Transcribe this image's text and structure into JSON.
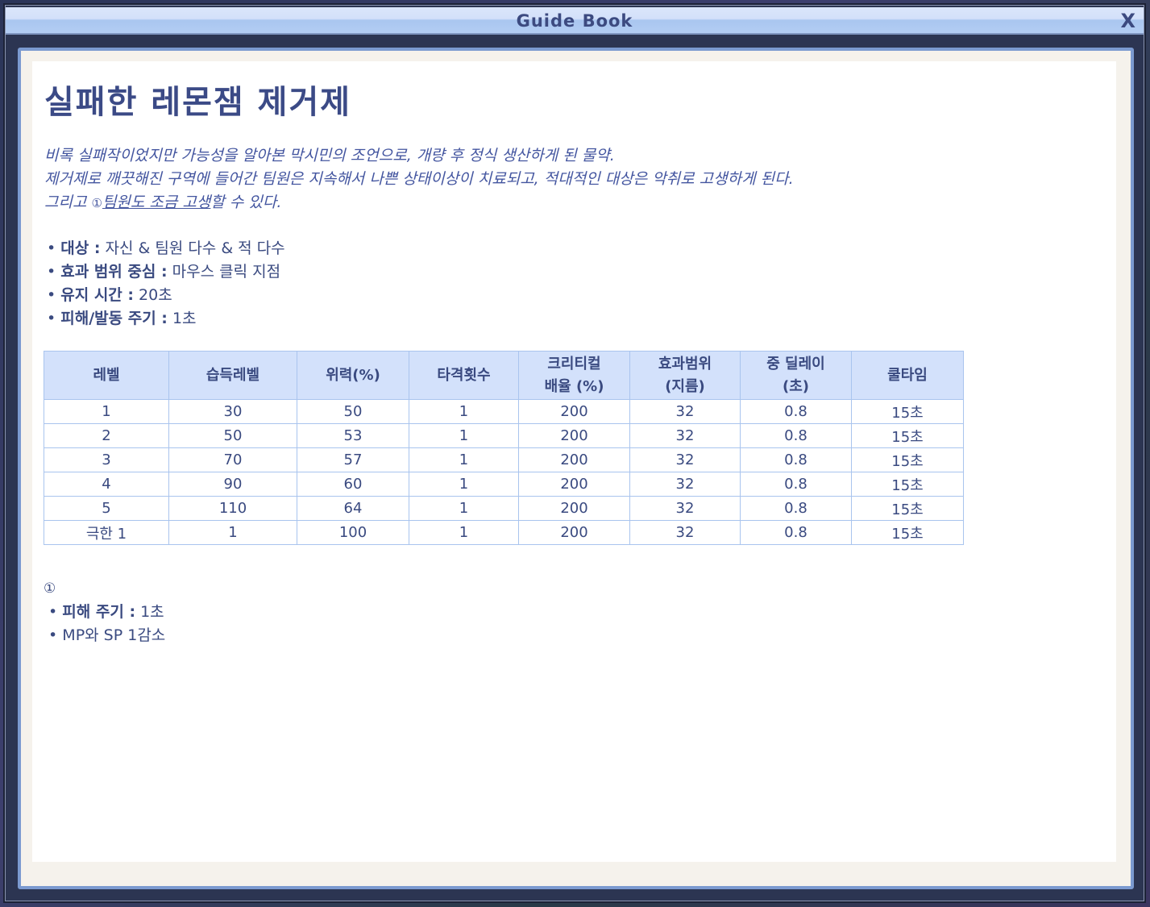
{
  "window": {
    "title": "Guide Book",
    "close_label": "X"
  },
  "page": {
    "title": "실패한 레몬잼 제거제",
    "description": {
      "line1": "비록 실패작이었지만 가능성을 알아본 막시민의 조언으로, 개량 후 정식 생산하게 된 물약.",
      "line2": "제거제로 깨끗해진 구역에 들어간 팀원은 지속해서 나쁜 상태이상이 치료되고, 적대적인 대상은 악취로 고생하게 된다.",
      "line3_prefix": "그리고 ",
      "line3_marker": "①",
      "line3_link": "팀원도 조금 고생",
      "line3_suffix": "할 수 있다."
    },
    "properties": [
      {
        "label": "대상 :",
        "value": " 자신 & 팀원 다수 & 적 다수"
      },
      {
        "label": "효과 범위 중심 :",
        "value": " 마우스 클릭 지점"
      },
      {
        "label": "유지 시간 :",
        "value": " 20초"
      },
      {
        "label": "피해/발동 주기 :",
        "value": " 1초"
      }
    ],
    "table": {
      "headers": [
        "레벨",
        "습득레벨",
        "위력(%)",
        "타격횟수",
        "크리티컬\n배율 (%)",
        "효과범위\n(지름)",
        "중 딜레이\n(초)",
        "쿨타임"
      ],
      "rows": [
        [
          "1",
          "30",
          "50",
          "1",
          "200",
          "32",
          "0.8",
          "15초"
        ],
        [
          "2",
          "50",
          "53",
          "1",
          "200",
          "32",
          "0.8",
          "15초"
        ],
        [
          "3",
          "70",
          "57",
          "1",
          "200",
          "32",
          "0.8",
          "15초"
        ],
        [
          "4",
          "90",
          "60",
          "1",
          "200",
          "32",
          "0.8",
          "15초"
        ],
        [
          "5",
          "110",
          "64",
          "1",
          "200",
          "32",
          "0.8",
          "15초"
        ],
        [
          "극한 1",
          "1",
          "100",
          "1",
          "200",
          "32",
          "0.8",
          "15초"
        ]
      ]
    },
    "notes": {
      "marker": "①",
      "items": [
        {
          "label": "피해 주기 :",
          "value": " 1초"
        },
        {
          "label": "",
          "value": "MP와 SP 1감소"
        }
      ]
    }
  }
}
